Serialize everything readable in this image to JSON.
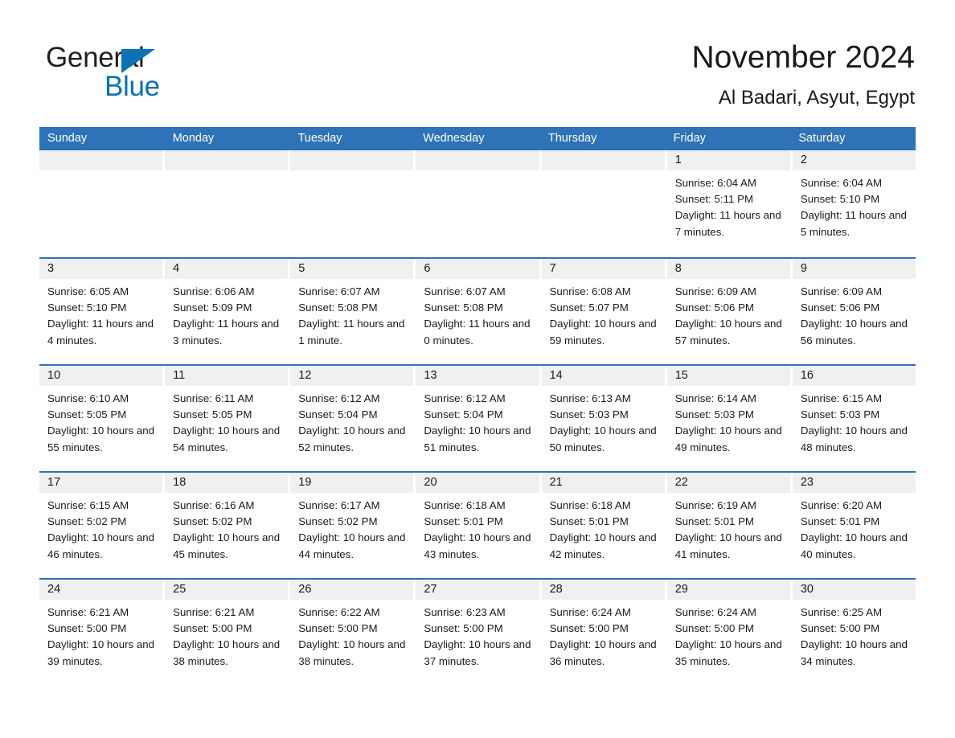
{
  "brand": {
    "name_part1": "General",
    "name_part2": "Blue",
    "triangle_icon": "triangle-icon",
    "accent_color": "#0b72b5"
  },
  "header": {
    "month_title": "November 2024",
    "location": "Al Badari, Asyut, Egypt"
  },
  "calendar": {
    "header_color": "#2e72b8",
    "day_band_color": "#f0f0f0",
    "weekdays": [
      "Sunday",
      "Monday",
      "Tuesday",
      "Wednesday",
      "Thursday",
      "Friday",
      "Saturday"
    ],
    "weeks": [
      [
        {
          "day": "",
          "sunrise": "",
          "sunset": "",
          "daylight": "",
          "empty": true
        },
        {
          "day": "",
          "sunrise": "",
          "sunset": "",
          "daylight": "",
          "empty": true
        },
        {
          "day": "",
          "sunrise": "",
          "sunset": "",
          "daylight": "",
          "empty": true
        },
        {
          "day": "",
          "sunrise": "",
          "sunset": "",
          "daylight": "",
          "empty": true
        },
        {
          "day": "",
          "sunrise": "",
          "sunset": "",
          "daylight": "",
          "empty": true
        },
        {
          "day": "1",
          "sunrise": "Sunrise: 6:04 AM",
          "sunset": "Sunset: 5:11 PM",
          "daylight": "Daylight: 11 hours and 7 minutes.",
          "empty": false
        },
        {
          "day": "2",
          "sunrise": "Sunrise: 6:04 AM",
          "sunset": "Sunset: 5:10 PM",
          "daylight": "Daylight: 11 hours and 5 minutes.",
          "empty": false
        }
      ],
      [
        {
          "day": "3",
          "sunrise": "Sunrise: 6:05 AM",
          "sunset": "Sunset: 5:10 PM",
          "daylight": "Daylight: 11 hours and 4 minutes.",
          "empty": false
        },
        {
          "day": "4",
          "sunrise": "Sunrise: 6:06 AM",
          "sunset": "Sunset: 5:09 PM",
          "daylight": "Daylight: 11 hours and 3 minutes.",
          "empty": false
        },
        {
          "day": "5",
          "sunrise": "Sunrise: 6:07 AM",
          "sunset": "Sunset: 5:08 PM",
          "daylight": "Daylight: 11 hours and 1 minute.",
          "empty": false
        },
        {
          "day": "6",
          "sunrise": "Sunrise: 6:07 AM",
          "sunset": "Sunset: 5:08 PM",
          "daylight": "Daylight: 11 hours and 0 minutes.",
          "empty": false
        },
        {
          "day": "7",
          "sunrise": "Sunrise: 6:08 AM",
          "sunset": "Sunset: 5:07 PM",
          "daylight": "Daylight: 10 hours and 59 minutes.",
          "empty": false
        },
        {
          "day": "8",
          "sunrise": "Sunrise: 6:09 AM",
          "sunset": "Sunset: 5:06 PM",
          "daylight": "Daylight: 10 hours and 57 minutes.",
          "empty": false
        },
        {
          "day": "9",
          "sunrise": "Sunrise: 6:09 AM",
          "sunset": "Sunset: 5:06 PM",
          "daylight": "Daylight: 10 hours and 56 minutes.",
          "empty": false
        }
      ],
      [
        {
          "day": "10",
          "sunrise": "Sunrise: 6:10 AM",
          "sunset": "Sunset: 5:05 PM",
          "daylight": "Daylight: 10 hours and 55 minutes.",
          "empty": false
        },
        {
          "day": "11",
          "sunrise": "Sunrise: 6:11 AM",
          "sunset": "Sunset: 5:05 PM",
          "daylight": "Daylight: 10 hours and 54 minutes.",
          "empty": false
        },
        {
          "day": "12",
          "sunrise": "Sunrise: 6:12 AM",
          "sunset": "Sunset: 5:04 PM",
          "daylight": "Daylight: 10 hours and 52 minutes.",
          "empty": false
        },
        {
          "day": "13",
          "sunrise": "Sunrise: 6:12 AM",
          "sunset": "Sunset: 5:04 PM",
          "daylight": "Daylight: 10 hours and 51 minutes.",
          "empty": false
        },
        {
          "day": "14",
          "sunrise": "Sunrise: 6:13 AM",
          "sunset": "Sunset: 5:03 PM",
          "daylight": "Daylight: 10 hours and 50 minutes.",
          "empty": false
        },
        {
          "day": "15",
          "sunrise": "Sunrise: 6:14 AM",
          "sunset": "Sunset: 5:03 PM",
          "daylight": "Daylight: 10 hours and 49 minutes.",
          "empty": false
        },
        {
          "day": "16",
          "sunrise": "Sunrise: 6:15 AM",
          "sunset": "Sunset: 5:03 PM",
          "daylight": "Daylight: 10 hours and 48 minutes.",
          "empty": false
        }
      ],
      [
        {
          "day": "17",
          "sunrise": "Sunrise: 6:15 AM",
          "sunset": "Sunset: 5:02 PM",
          "daylight": "Daylight: 10 hours and 46 minutes.",
          "empty": false
        },
        {
          "day": "18",
          "sunrise": "Sunrise: 6:16 AM",
          "sunset": "Sunset: 5:02 PM",
          "daylight": "Daylight: 10 hours and 45 minutes.",
          "empty": false
        },
        {
          "day": "19",
          "sunrise": "Sunrise: 6:17 AM",
          "sunset": "Sunset: 5:02 PM",
          "daylight": "Daylight: 10 hours and 44 minutes.",
          "empty": false
        },
        {
          "day": "20",
          "sunrise": "Sunrise: 6:18 AM",
          "sunset": "Sunset: 5:01 PM",
          "daylight": "Daylight: 10 hours and 43 minutes.",
          "empty": false
        },
        {
          "day": "21",
          "sunrise": "Sunrise: 6:18 AM",
          "sunset": "Sunset: 5:01 PM",
          "daylight": "Daylight: 10 hours and 42 minutes.",
          "empty": false
        },
        {
          "day": "22",
          "sunrise": "Sunrise: 6:19 AM",
          "sunset": "Sunset: 5:01 PM",
          "daylight": "Daylight: 10 hours and 41 minutes.",
          "empty": false
        },
        {
          "day": "23",
          "sunrise": "Sunrise: 6:20 AM",
          "sunset": "Sunset: 5:01 PM",
          "daylight": "Daylight: 10 hours and 40 minutes.",
          "empty": false
        }
      ],
      [
        {
          "day": "24",
          "sunrise": "Sunrise: 6:21 AM",
          "sunset": "Sunset: 5:00 PM",
          "daylight": "Daylight: 10 hours and 39 minutes.",
          "empty": false
        },
        {
          "day": "25",
          "sunrise": "Sunrise: 6:21 AM",
          "sunset": "Sunset: 5:00 PM",
          "daylight": "Daylight: 10 hours and 38 minutes.",
          "empty": false
        },
        {
          "day": "26",
          "sunrise": "Sunrise: 6:22 AM",
          "sunset": "Sunset: 5:00 PM",
          "daylight": "Daylight: 10 hours and 38 minutes.",
          "empty": false
        },
        {
          "day": "27",
          "sunrise": "Sunrise: 6:23 AM",
          "sunset": "Sunset: 5:00 PM",
          "daylight": "Daylight: 10 hours and 37 minutes.",
          "empty": false
        },
        {
          "day": "28",
          "sunrise": "Sunrise: 6:24 AM",
          "sunset": "Sunset: 5:00 PM",
          "daylight": "Daylight: 10 hours and 36 minutes.",
          "empty": false
        },
        {
          "day": "29",
          "sunrise": "Sunrise: 6:24 AM",
          "sunset": "Sunset: 5:00 PM",
          "daylight": "Daylight: 10 hours and 35 minutes.",
          "empty": false
        },
        {
          "day": "30",
          "sunrise": "Sunrise: 6:25 AM",
          "sunset": "Sunset: 5:00 PM",
          "daylight": "Daylight: 10 hours and 34 minutes.",
          "empty": false
        }
      ]
    ]
  }
}
